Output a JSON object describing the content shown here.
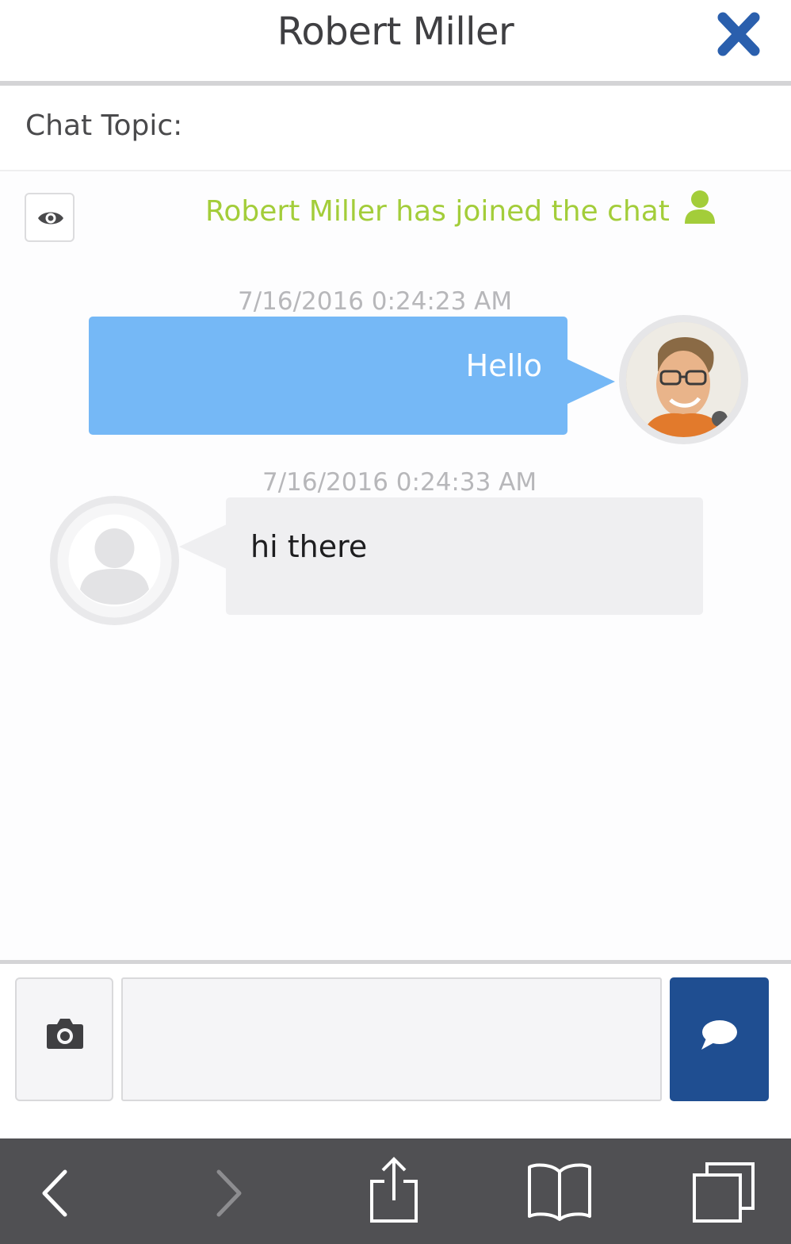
{
  "header": {
    "title": "Robert Miller",
    "close_icon": "close-icon",
    "accent_color": "#2a5fad"
  },
  "topic": {
    "label": "Chat Topic:"
  },
  "system": {
    "join_message": "Robert Miller has joined the chat",
    "join_color": "#a3cd3a",
    "eye_icon": "eye-icon",
    "user_icon": "user-icon"
  },
  "messages": [
    {
      "timestamp": "7/16/2016 0:24:23 AM",
      "text": "Hello",
      "direction": "outgoing",
      "bubble_color": "#75b8f6"
    },
    {
      "timestamp": "7/16/2016 0:24:33 AM",
      "text": "hi there",
      "direction": "incoming",
      "bubble_color": "#efeff1"
    }
  ],
  "composer": {
    "camera_icon": "camera-icon",
    "input_value": "",
    "send_icon": "speech-bubble-icon",
    "send_color": "#1f4e91"
  },
  "browser_toolbar": {
    "icons": [
      "back-icon",
      "forward-icon",
      "share-icon",
      "bookmarks-icon",
      "tabs-icon"
    ]
  }
}
